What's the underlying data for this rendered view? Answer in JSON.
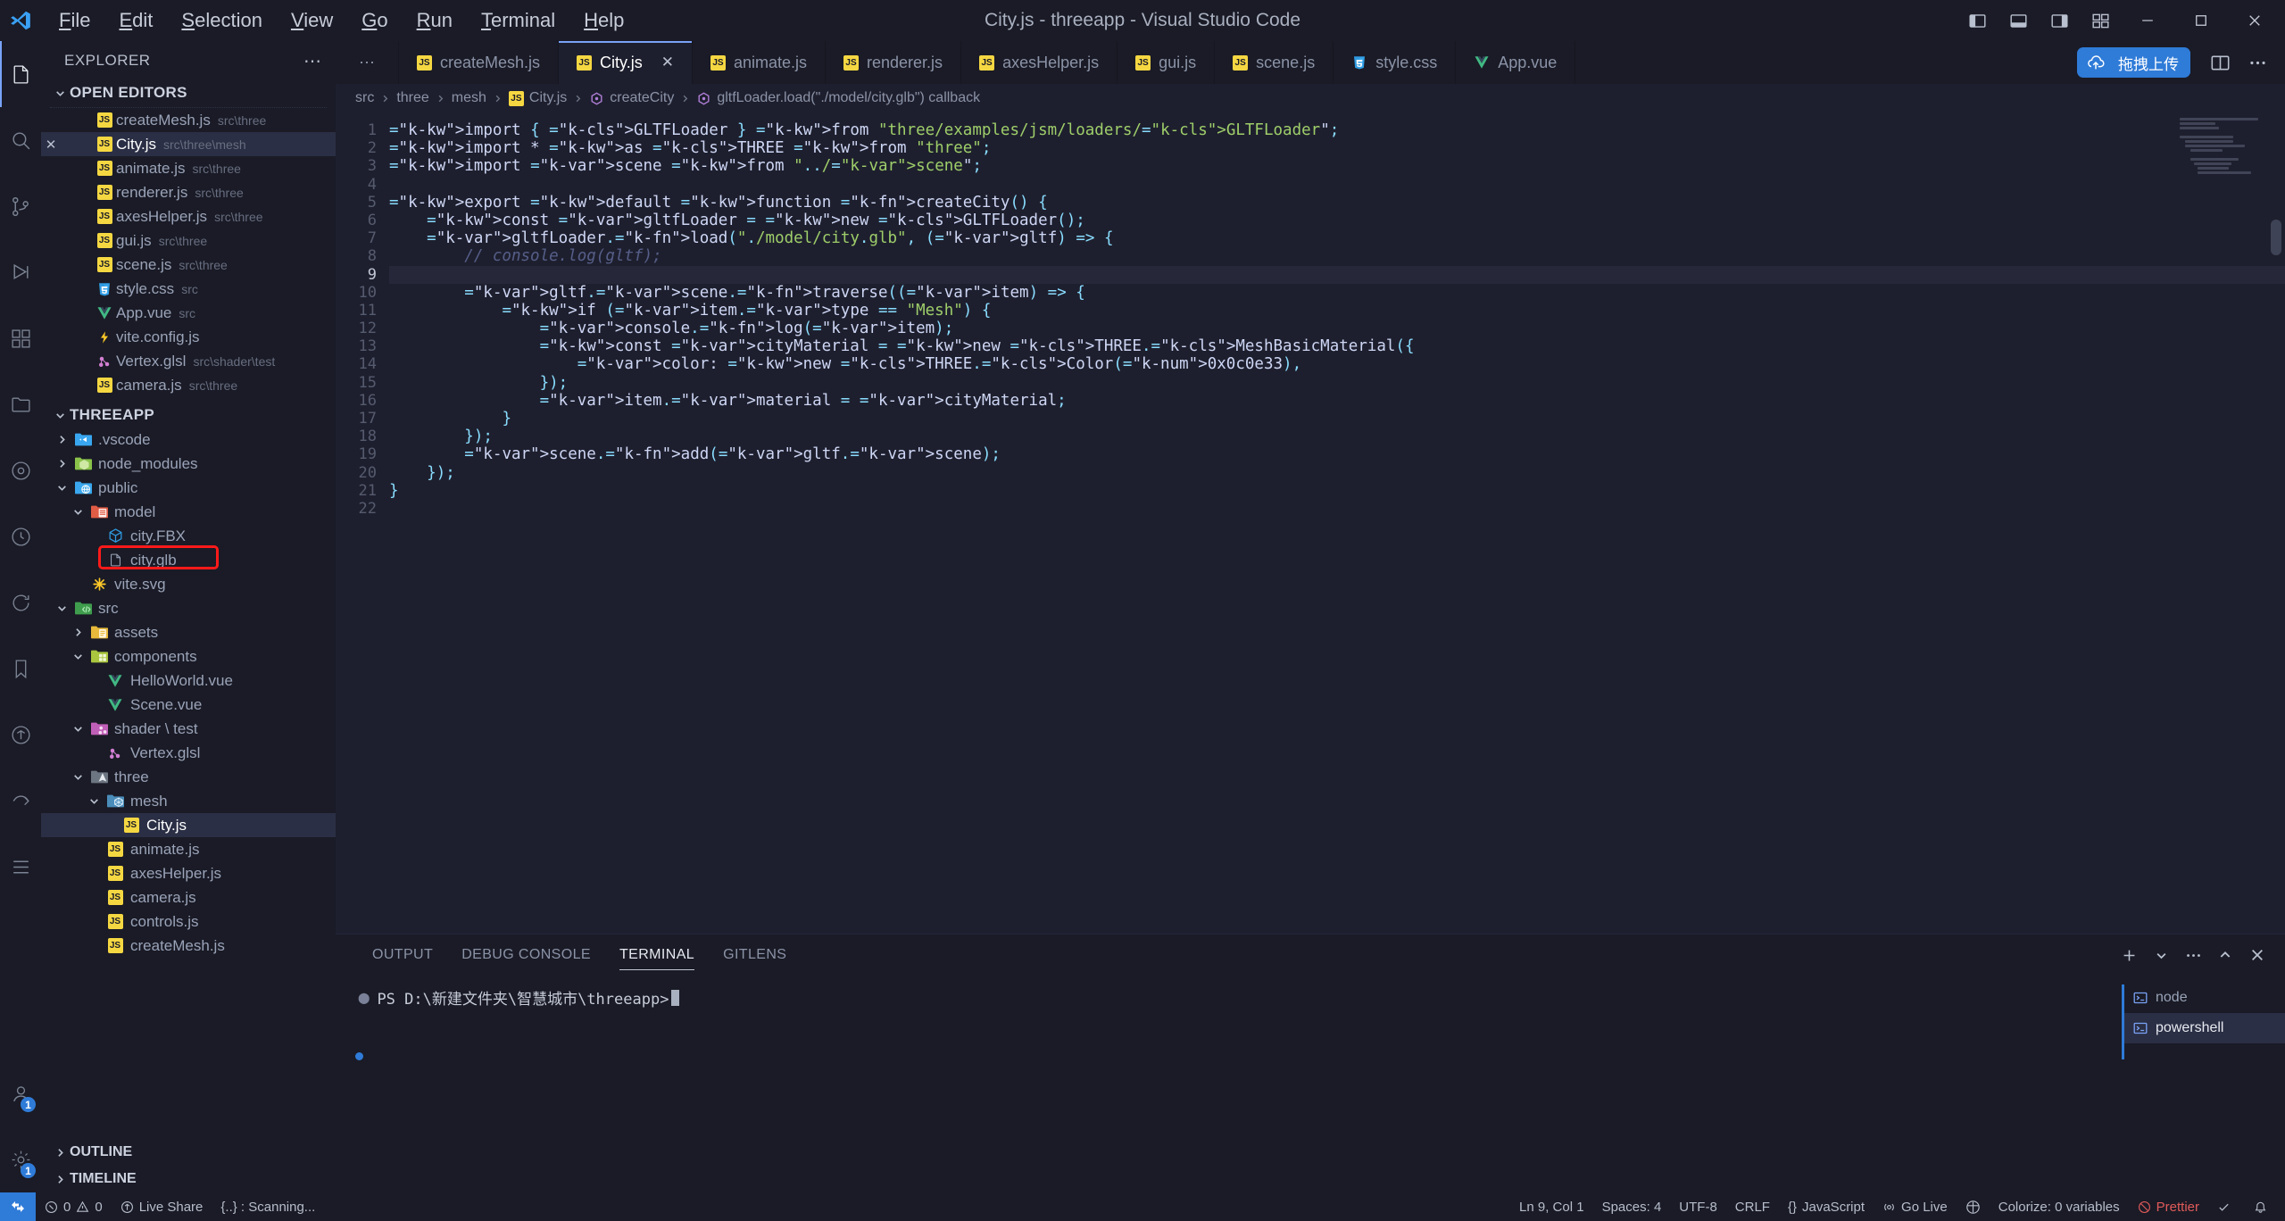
{
  "titlebar": {
    "title": "City.js - threeapp - Visual Studio Code",
    "menus": [
      "File",
      "Edit",
      "Selection",
      "View",
      "Go",
      "Run",
      "Terminal",
      "Help"
    ],
    "layout_icons": [
      "panel-left-icon",
      "panel-bottom-icon",
      "panel-right-icon",
      "customize-layout-icon"
    ],
    "window_controls": [
      "minimize-button",
      "maximize-button",
      "close-button"
    ]
  },
  "activitybar": {
    "items": [
      {
        "name": "explorer",
        "icon": "files-icon",
        "active": true,
        "badge": ""
      },
      {
        "name": "search",
        "icon": "search-icon",
        "active": false,
        "badge": ""
      },
      {
        "name": "source-control",
        "icon": "source-control-icon",
        "active": false,
        "badge": ""
      },
      {
        "name": "run-and-debug",
        "icon": "debug-icon",
        "active": false,
        "badge": ""
      },
      {
        "name": "extensions",
        "icon": "extensions-icon",
        "active": false,
        "badge": ""
      },
      {
        "name": "remote-explorer",
        "icon": "folder-icon",
        "active": false,
        "badge": ""
      },
      {
        "name": "testing",
        "icon": "beaker-icon",
        "active": false,
        "badge": ""
      },
      {
        "name": "clock",
        "icon": "clock-icon",
        "active": false,
        "badge": ""
      },
      {
        "name": "sync",
        "icon": "sync-icon",
        "active": false,
        "badge": ""
      },
      {
        "name": "bookmarks",
        "icon": "bookmark-icon",
        "active": false,
        "badge": ""
      },
      {
        "name": "live-share",
        "icon": "live-share-icon",
        "active": false,
        "badge": ""
      },
      {
        "name": "share",
        "icon": "share-icon",
        "active": false,
        "badge": ""
      },
      {
        "name": "todo",
        "icon": "list-icon",
        "active": false,
        "badge": ""
      }
    ],
    "bottom": [
      {
        "name": "accounts",
        "icon": "account-icon",
        "badge": "1"
      },
      {
        "name": "settings",
        "icon": "gear-icon",
        "badge": "1"
      }
    ]
  },
  "sidebar": {
    "title": "EXPLORER",
    "more_label": "⋯",
    "open_editors": {
      "label": "OPEN EDITORS",
      "expanded": true,
      "items": [
        {
          "name": "createMesh.js",
          "desc": "src\\three",
          "icon": "js-icon",
          "active": false,
          "dirty": false
        },
        {
          "name": "City.js",
          "desc": "src\\three\\mesh",
          "icon": "js-icon",
          "active": true,
          "dirty": false
        },
        {
          "name": "animate.js",
          "desc": "src\\three",
          "icon": "js-icon",
          "active": false,
          "dirty": false
        },
        {
          "name": "renderer.js",
          "desc": "src\\three",
          "icon": "js-icon",
          "active": false,
          "dirty": false
        },
        {
          "name": "axesHelper.js",
          "desc": "src\\three",
          "icon": "js-icon",
          "active": false,
          "dirty": false
        },
        {
          "name": "gui.js",
          "desc": "src\\three",
          "icon": "js-icon",
          "active": false,
          "dirty": false
        },
        {
          "name": "scene.js",
          "desc": "src\\three",
          "icon": "js-icon",
          "active": false,
          "dirty": false
        },
        {
          "name": "style.css",
          "desc": "src",
          "icon": "css-icon",
          "active": false,
          "dirty": false
        },
        {
          "name": "App.vue",
          "desc": "src",
          "icon": "vue-icon",
          "active": false,
          "dirty": false
        },
        {
          "name": "vite.config.js",
          "desc": "",
          "icon": "vite-icon",
          "active": false,
          "dirty": false
        },
        {
          "name": "Vertex.glsl",
          "desc": "src\\shader\\test",
          "icon": "glsl-icon",
          "active": false,
          "dirty": false
        },
        {
          "name": "camera.js",
          "desc": "src\\three",
          "icon": "js-icon",
          "active": false,
          "dirty": false
        }
      ]
    },
    "workspace": {
      "label": "THREEAPP",
      "expanded": true,
      "tree": [
        {
          "name": ".vscode",
          "type": "folder",
          "icon": "folder-vscode-icon",
          "indent": 1,
          "expanded": false,
          "selected": false
        },
        {
          "name": "node_modules",
          "type": "folder",
          "icon": "folder-node-icon",
          "indent": 1,
          "expanded": false,
          "selected": false
        },
        {
          "name": "public",
          "type": "folder",
          "icon": "folder-public-icon",
          "indent": 1,
          "expanded": true,
          "selected": false
        },
        {
          "name": "model",
          "type": "folder",
          "icon": "folder-model-icon",
          "indent": 2,
          "expanded": true,
          "selected": false
        },
        {
          "name": "city.FBX",
          "type": "file",
          "icon": "cube-icon",
          "indent": 3,
          "selected": false
        },
        {
          "name": "city.glb",
          "type": "file",
          "icon": "file-icon",
          "indent": 3,
          "selected": false,
          "highlighted": true
        },
        {
          "name": "vite.svg",
          "type": "file",
          "icon": "svg-icon",
          "indent": 2,
          "selected": false
        },
        {
          "name": "src",
          "type": "folder",
          "icon": "folder-src-icon",
          "indent": 1,
          "expanded": true,
          "selected": false
        },
        {
          "name": "assets",
          "type": "folder",
          "icon": "folder-assets-icon",
          "indent": 2,
          "expanded": false,
          "selected": false
        },
        {
          "name": "components",
          "type": "folder",
          "icon": "folder-components-icon",
          "indent": 2,
          "expanded": true,
          "selected": false
        },
        {
          "name": "HelloWorld.vue",
          "type": "file",
          "icon": "vue-icon",
          "indent": 3,
          "selected": false
        },
        {
          "name": "Scene.vue",
          "type": "file",
          "icon": "vue-icon",
          "indent": 3,
          "selected": false
        },
        {
          "name": "shader \\ test",
          "type": "folder",
          "icon": "folder-shader-icon",
          "indent": 2,
          "expanded": true,
          "selected": false
        },
        {
          "name": "Vertex.glsl",
          "type": "file",
          "icon": "glsl-icon",
          "indent": 3,
          "selected": false
        },
        {
          "name": "three",
          "type": "folder",
          "icon": "folder-three-icon",
          "indent": 2,
          "expanded": true,
          "selected": false
        },
        {
          "name": "mesh",
          "type": "folder",
          "icon": "folder-mesh-icon",
          "indent": 3,
          "expanded": true,
          "selected": false
        },
        {
          "name": "City.js",
          "type": "file",
          "icon": "js-icon",
          "indent": 4,
          "selected": true
        },
        {
          "name": "animate.js",
          "type": "file",
          "icon": "js-icon",
          "indent": 3,
          "selected": false
        },
        {
          "name": "axesHelper.js",
          "type": "file",
          "icon": "js-icon",
          "indent": 3,
          "selected": false
        },
        {
          "name": "camera.js",
          "type": "file",
          "icon": "js-icon",
          "indent": 3,
          "selected": false
        },
        {
          "name": "controls.js",
          "type": "file",
          "icon": "js-icon",
          "indent": 3,
          "selected": false
        },
        {
          "name": "createMesh.js",
          "type": "file",
          "icon": "js-icon",
          "indent": 3,
          "selected": false
        }
      ]
    },
    "outline_label": "OUTLINE",
    "timeline_label": "TIMELINE"
  },
  "tabs": [
    {
      "label": "createMesh.js",
      "icon": "js-icon",
      "active": false,
      "closable": false
    },
    {
      "label": "City.js",
      "icon": "js-icon",
      "active": true,
      "closable": true
    },
    {
      "label": "animate.js",
      "icon": "js-icon",
      "active": false,
      "closable": false
    },
    {
      "label": "renderer.js",
      "icon": "js-icon",
      "active": false,
      "closable": false
    },
    {
      "label": "axesHelper.js",
      "icon": "js-icon",
      "active": false,
      "closable": false
    },
    {
      "label": "gui.js",
      "icon": "js-icon",
      "active": false,
      "closable": false
    },
    {
      "label": "scene.js",
      "icon": "js-icon",
      "active": false,
      "closable": false
    },
    {
      "label": "style.css",
      "icon": "css-icon",
      "active": false,
      "closable": false
    },
    {
      "label": "App.vue",
      "icon": "vue-icon",
      "active": false,
      "closable": false
    }
  ],
  "tab_overflow_label": "⋯",
  "tab_actions": {
    "upload_button_label": "拖拽上传",
    "upload_icon": "cloud-upload-icon",
    "split_editor_icon": "split-editor-icon",
    "more_actions_icon": "more-actions-icon"
  },
  "breadcrumb": [
    {
      "label": "src",
      "icon": ""
    },
    {
      "label": "three",
      "icon": ""
    },
    {
      "label": "mesh",
      "icon": ""
    },
    {
      "label": "City.js",
      "icon": "js-icon"
    },
    {
      "label": "createCity",
      "icon": "method-icon"
    },
    {
      "label": "gltfLoader.load(\"./model/city.glb\") callback",
      "icon": "method-icon"
    }
  ],
  "editor": {
    "current_line": 9,
    "total_lines": 22,
    "line_numbers": [
      "1",
      "2",
      "3",
      "4",
      "5",
      "6",
      "7",
      "8",
      "9",
      "10",
      "11",
      "12",
      "13",
      "14",
      "15",
      "16",
      "17",
      "18",
      "19",
      "20",
      "21",
      "22"
    ],
    "code_lines": [
      "import { GLTFLoader } from \"three/examples/jsm/loaders/GLTFLoader\";",
      "import * as THREE from \"three\";",
      "import scene from \"../scene\";",
      "",
      "export default function createCity() {",
      "    const gltfLoader = new GLTFLoader();",
      "    gltfLoader.load(\"./model/city.glb\", (gltf) => {",
      "        // console.log(gltf);",
      "",
      "        gltf.scene.traverse((item) => {",
      "            if (item.type == \"Mesh\") {",
      "                console.log(item);",
      "                const cityMaterial = new THREE.MeshBasicMaterial({",
      "                    color: new THREE.Color(0x0c0e33),",
      "                });",
      "                item.material = cityMaterial;",
      "            }",
      "        });",
      "        scene.add(gltf.scene);",
      "    });",
      "}",
      ""
    ]
  },
  "panel": {
    "tabs": [
      {
        "label": "OUTPUT",
        "active": false
      },
      {
        "label": "DEBUG CONSOLE",
        "active": false
      },
      {
        "label": "TERMINAL",
        "active": true
      },
      {
        "label": "GITLENS",
        "active": false
      }
    ],
    "actions": [
      "add-terminal-icon",
      "terminal-dropdown-icon",
      "more-actions-icon",
      "maximize-panel-icon",
      "close-panel-icon"
    ],
    "terminal_prompt": "PS D:\\新建文件夹\\智慧城市\\threeapp>",
    "terminal_list": [
      {
        "label": "node",
        "icon": "terminal-icon",
        "active": false
      },
      {
        "label": "powershell",
        "icon": "terminal-icon",
        "active": true
      }
    ]
  },
  "statusbar": {
    "left": [
      {
        "name": "remote-indicator",
        "label": "",
        "icon": "remote-icon"
      },
      {
        "name": "problems",
        "label": "0  0",
        "icon": "error-warning-icon"
      },
      {
        "name": "live-share",
        "label": "Live Share",
        "icon": "live-share-icon"
      },
      {
        "name": "scanning",
        "label": "{..} : Scanning...",
        "icon": ""
      }
    ],
    "right": [
      {
        "name": "cursor-position",
        "label": "Ln 9, Col 1",
        "icon": ""
      },
      {
        "name": "indentation",
        "label": "Spaces: 4",
        "icon": ""
      },
      {
        "name": "encoding",
        "label": "UTF-8",
        "icon": ""
      },
      {
        "name": "eol",
        "label": "CRLF",
        "icon": ""
      },
      {
        "name": "language-mode",
        "label": "JavaScript",
        "icon": "braces-icon"
      },
      {
        "name": "go-live",
        "label": "Go Live",
        "icon": "broadcast-icon"
      },
      {
        "name": "gitlens",
        "label": "",
        "icon": "gitlens-icon"
      },
      {
        "name": "colorize-variables",
        "label": "Colorize: 0 variables",
        "icon": ""
      },
      {
        "name": "colorize",
        "label": "Colorize",
        "icon": "circle-slash-icon"
      },
      {
        "name": "prettier",
        "label": "Prettier",
        "icon": "check-icon"
      },
      {
        "name": "notifications",
        "label": "",
        "icon": "bell-icon"
      }
    ]
  },
  "colors": {
    "accent": "#7aa2f7",
    "brand_blue": "#2f7bd8",
    "highlight_red": "#ff1a1a",
    "background": "#1a1b26",
    "editor_bg": "#1e1f2e",
    "js_yellow": "#f5d742"
  }
}
